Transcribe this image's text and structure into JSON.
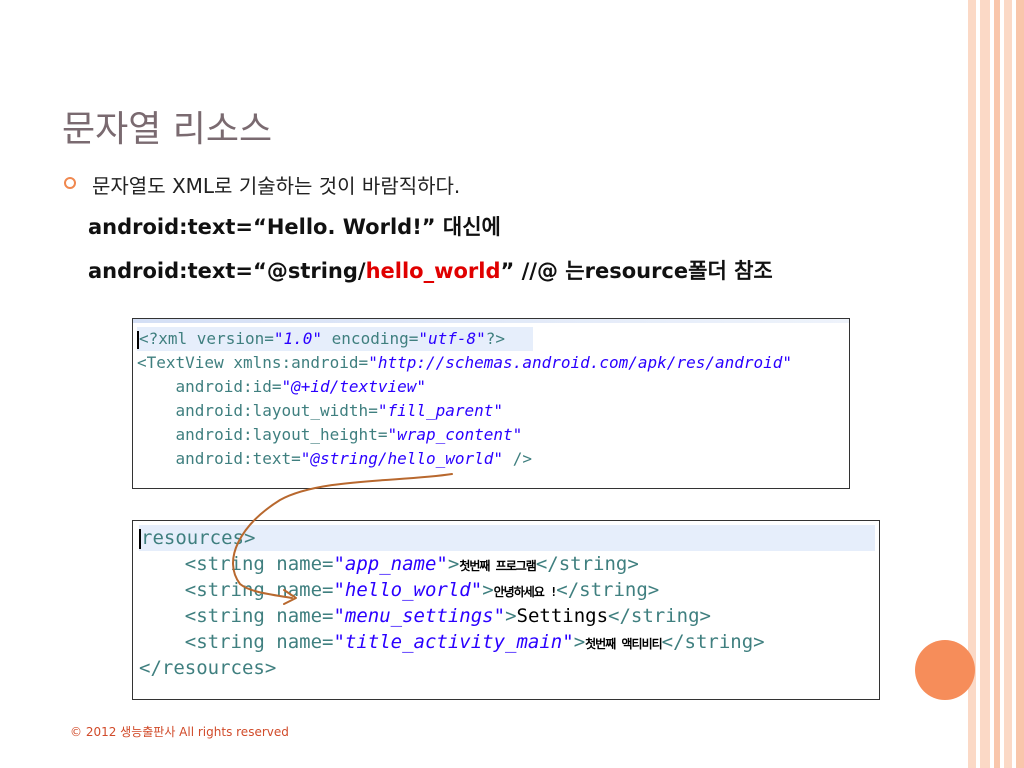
{
  "slide": {
    "title": "문자열 리소스",
    "bullet_text": "문자열도 XML로 기술하는 것이 바람직하다.",
    "line2_text": "android:text=“Hello. World!” 대신에",
    "line3_prefix": "android:text=“@string/",
    "line3_highlight": "hello_world",
    "line3_suffix": "” //@ 는resource폴더 참조"
  },
  "code_top": {
    "l1_open": "<?xml version=",
    "l1_v1": "\"1.0\"",
    "l1_mid": " encoding=",
    "l1_v2": "\"utf-8\"",
    "l1_close": "?>",
    "l2_tag": "<TextView xmlns:android=",
    "l2_val": "\"http://schemas.android.com/apk/res/android\"",
    "l3_attr": "    android:id=",
    "l3_val": "\"@+id/textview\"",
    "l4_attr": "    android:layout_width=",
    "l4_val": "\"fill_parent\"",
    "l5_attr": "    android:layout_height=",
    "l5_val": "\"wrap_content\"",
    "l6_attr": "    android:text=",
    "l6_val": "\"@string/hello_world\"",
    "l6_end": " />"
  },
  "code_bottom": {
    "open_tag": "resources>",
    "r1_tag": "    <string name=",
    "r1_val": "\"app_name\"",
    "r1_text": "첫번째 프로그램",
    "r2_tag": "    <string name=",
    "r2_val": "\"hello_world\"",
    "r2_text": "안녕하세요 !",
    "r3_tag": "    <string name=",
    "r3_val": "\"menu_settings\"",
    "r3_text": "Settings",
    "r4_tag": "    <string name=",
    "r4_val": "\"title_activity_main\"",
    "r4_text": "첫번째 액티비티",
    "close_str": "</string>",
    "close_tag": "</resources>"
  },
  "footer": "© 2012 생능출판사  All rights reserved"
}
